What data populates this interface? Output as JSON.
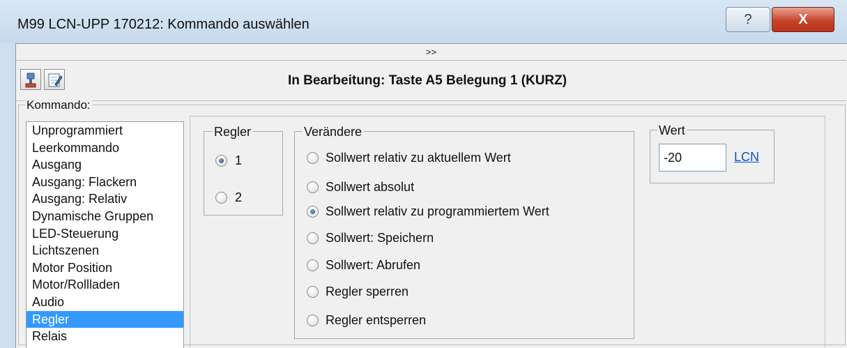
{
  "window": {
    "title": "M99 LCN-UPP 170212: Kommando auswählen",
    "help_glyph": "?",
    "close_glyph": "X"
  },
  "expand_bar": {
    "label": ">>"
  },
  "header": {
    "editing_text": "In Bearbeitung: Taste A5 Belegung 1 (KURZ)"
  },
  "kommando": {
    "legend": "Kommando:",
    "items": [
      "Unprogrammiert",
      "Leerkommando",
      "Ausgang",
      "Ausgang: Flackern",
      "Ausgang: Relativ",
      "Dynamische Gruppen",
      "LED-Steuerung",
      "Lichtszenen",
      "Motor Position",
      "Motor/Rollladen",
      "Audio",
      "Regler",
      "Relais"
    ],
    "selected": "Regler"
  },
  "regler": {
    "legend": "Regler",
    "options": [
      "1",
      "2"
    ],
    "selected": "1"
  },
  "veraendere": {
    "legend": "Verändere",
    "options": [
      "Sollwert relativ zu aktuellem Wert",
      "Sollwert absolut",
      "Sollwert relativ zu programmiertem Wert",
      "Sollwert: Speichern",
      "Sollwert: Abrufen",
      "Regler sperren",
      "Regler entsperren"
    ],
    "selected": "Sollwert relativ zu programmiertem Wert"
  },
  "wert": {
    "legend": "Wert",
    "value": "-20",
    "link": "LCN"
  },
  "icons": {
    "toolbar_1": "plug-icon",
    "toolbar_2": "edit-note-icon"
  }
}
